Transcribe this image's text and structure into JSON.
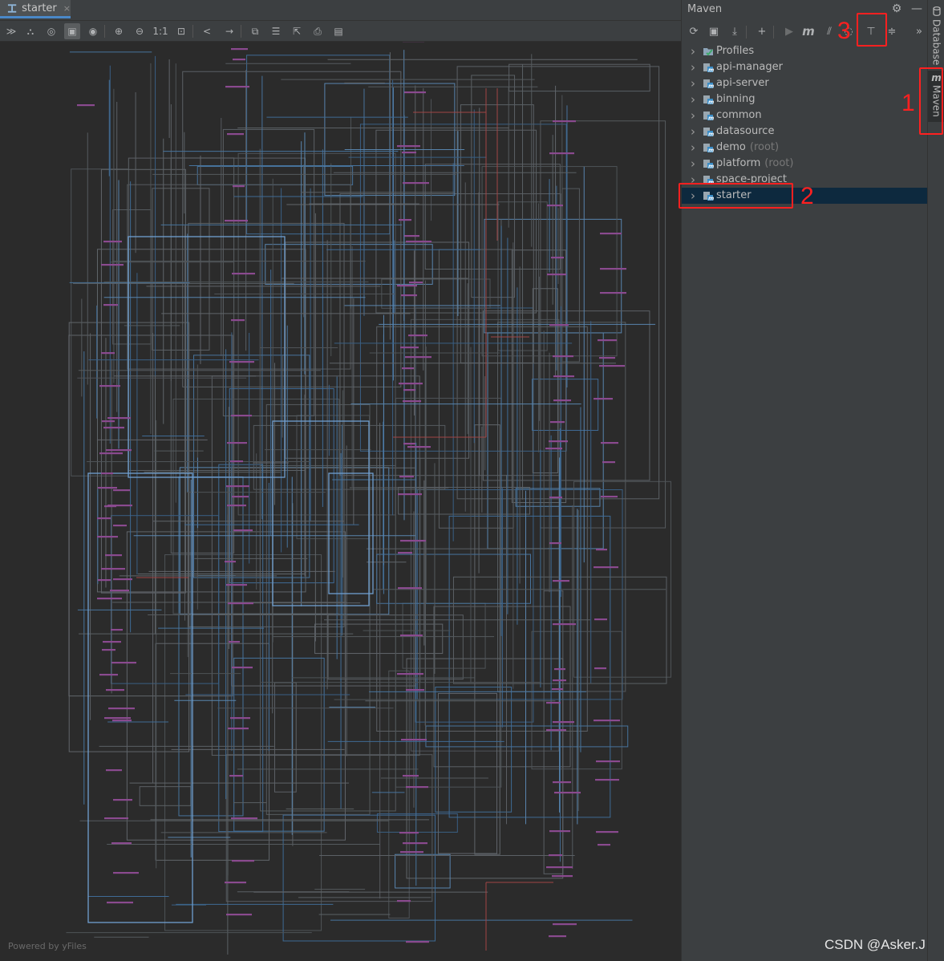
{
  "editor": {
    "tab_label": "starter",
    "tab_close": "×",
    "powered_by": "Powered by yFiles"
  },
  "toolbar": [
    {
      "icon": "collapse-icon",
      "glyph": "≫"
    },
    {
      "icon": "hierarchy-icon",
      "glyph": "⛬"
    },
    {
      "icon": "search-node-icon",
      "glyph": "◎"
    },
    {
      "icon": "select-all-icon",
      "glyph": "▣",
      "selected": true
    },
    {
      "icon": "eye-icon",
      "glyph": "◉"
    },
    {
      "icon": "zoom-in-icon",
      "glyph": "⊕"
    },
    {
      "icon": "zoom-out-icon",
      "glyph": "⊖"
    },
    {
      "icon": "actual-size-icon",
      "glyph": "1:1"
    },
    {
      "icon": "fit-content-icon",
      "glyph": "⊡"
    },
    {
      "icon": "share-icon",
      "glyph": "<"
    },
    {
      "icon": "jump-icon",
      "glyph": "→"
    },
    {
      "icon": "copy-icon",
      "glyph": "⧉"
    },
    {
      "icon": "layout-icon",
      "glyph": "☰"
    },
    {
      "icon": "export-icon",
      "glyph": "⇱"
    },
    {
      "icon": "print-icon",
      "glyph": "⎙"
    },
    {
      "icon": "save-icon",
      "glyph": "▤"
    }
  ],
  "maven": {
    "title": "Maven",
    "settings_glyph": "⚙",
    "minimize_glyph": "—",
    "toolbar": [
      {
        "icon": "reload-icon",
        "glyph": "⟳",
        "dim": false
      },
      {
        "icon": "add-folder-icon",
        "glyph": "▣",
        "dim": false
      },
      {
        "icon": "download-icon",
        "glyph": "⤓",
        "dim": false
      },
      {
        "icon": "plus-icon",
        "glyph": "+",
        "dim": false
      },
      {
        "icon": "run-icon",
        "glyph": "▶",
        "dim": true
      },
      {
        "icon": "maven-goal-icon",
        "glyph": "m",
        "dim": false
      },
      {
        "icon": "toggle-offline-icon",
        "glyph": "⫽",
        "dim": false
      },
      {
        "icon": "skip-tests-icon",
        "glyph": "◌",
        "dim": false
      },
      {
        "icon": "show-dependencies-icon",
        "glyph": "⊤",
        "dim": false
      },
      {
        "icon": "collapse-all-icon",
        "glyph": "≑",
        "dim": false
      },
      {
        "icon": "more-icon",
        "glyph": "»",
        "dim": false
      }
    ],
    "items": [
      {
        "label": "Profiles",
        "suffix": "",
        "type": "profiles"
      },
      {
        "label": "api-manager",
        "suffix": "",
        "type": "module"
      },
      {
        "label": "api-server",
        "suffix": "",
        "type": "module"
      },
      {
        "label": "binning",
        "suffix": "",
        "type": "module"
      },
      {
        "label": "common",
        "suffix": "",
        "type": "module"
      },
      {
        "label": "datasource",
        "suffix": "",
        "type": "module"
      },
      {
        "label": "demo",
        "suffix": "(root)",
        "type": "module"
      },
      {
        "label": "platform",
        "suffix": "(root)",
        "type": "module"
      },
      {
        "label": "space-project",
        "suffix": "",
        "type": "module"
      },
      {
        "label": "starter",
        "suffix": "",
        "type": "module",
        "selected": true
      }
    ]
  },
  "side_tabs": {
    "database": "Database",
    "maven": "Maven"
  },
  "annotations": [
    "1",
    "2",
    "3"
  ],
  "watermark": "CSDN @Asker.J",
  "colors": {
    "accent_blue": "#4a88c7",
    "selection": "#0d293e",
    "annotation_red": "#ff2020",
    "node_purple": "#8a4a8f"
  }
}
